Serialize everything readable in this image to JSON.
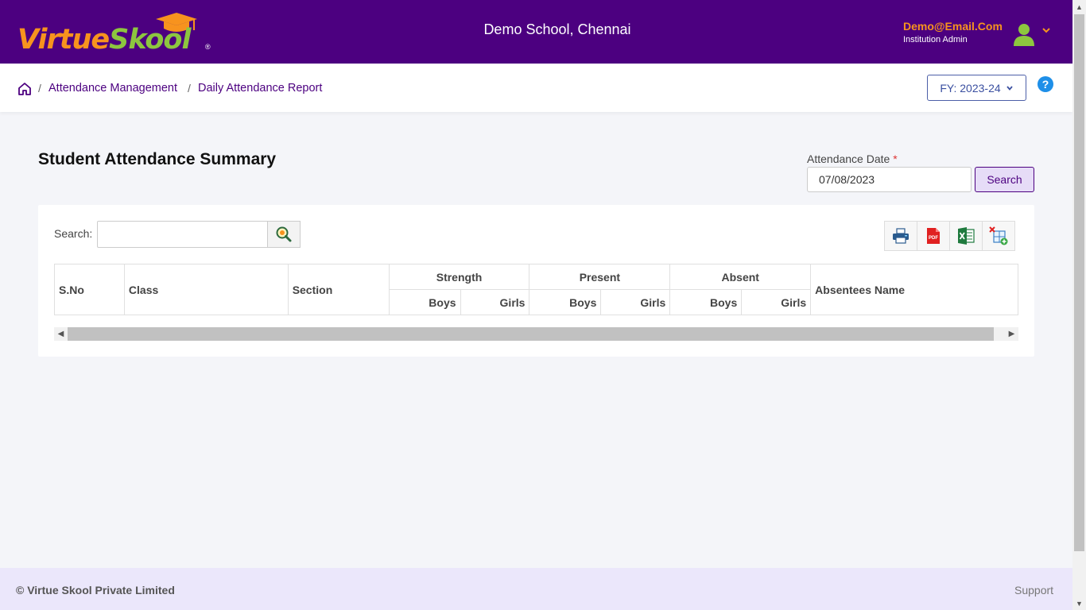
{
  "header": {
    "logo": {
      "part1": "Virtue",
      "part2": "Skool",
      "reg": "®"
    },
    "school_name": "Demo School, Chennai",
    "user_email": "Demo@Email.Com",
    "user_role": "Institution Admin",
    "colors": {
      "bar": "#4c0080",
      "accent": "#f7931e",
      "green": "#8dc63f"
    }
  },
  "breadcrumb": {
    "items": [
      "Attendance Management",
      "Daily Attendance Report"
    ],
    "separator": "/"
  },
  "fy_selector": {
    "label": "FY: 2023-24"
  },
  "help": {
    "glyph": "?"
  },
  "main": {
    "title": "Student Attendance Summary",
    "date_label": "Attendance Date",
    "required_mark": "*",
    "date_value": "07/08/2023",
    "search_button": "Search"
  },
  "table_toolbar": {
    "search_label": "Search:",
    "search_value": "",
    "export_buttons": [
      "print-icon",
      "pdf-icon",
      "excel-icon",
      "column-visibility-icon"
    ]
  },
  "table": {
    "headers": {
      "sno": "S.No",
      "class": "Class",
      "section": "Section",
      "strength": "Strength",
      "present": "Present",
      "absent": "Absent",
      "absentees": "Absentees Name",
      "boys": "Boys",
      "girls": "Girls"
    },
    "rows": []
  },
  "footer": {
    "copyright": "© Virtue Skool Private Limited",
    "support": "Support"
  }
}
